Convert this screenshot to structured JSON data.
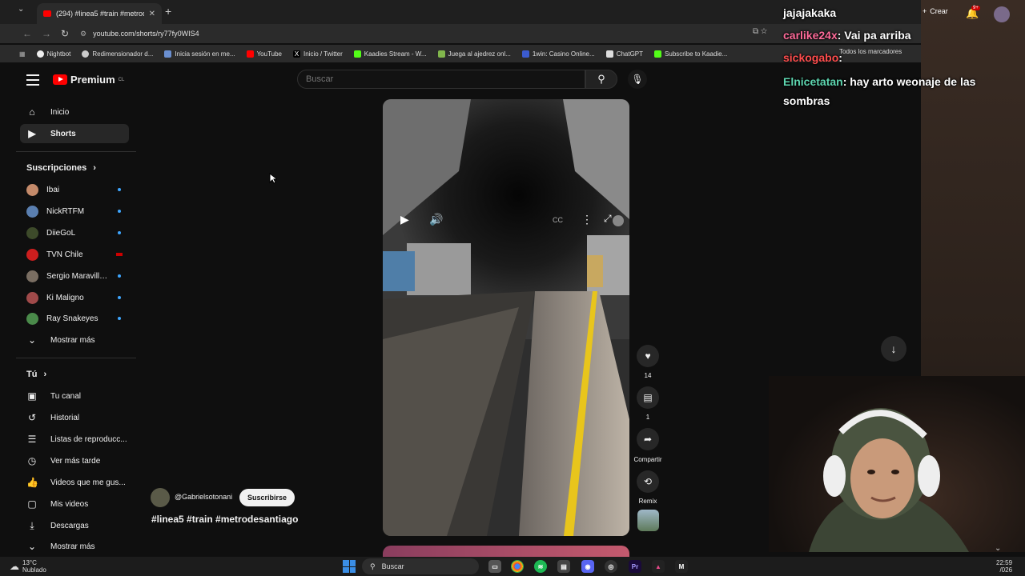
{
  "browser": {
    "tab_title": "(294) #linea5 #train #metrode",
    "url": "youtube.com/shorts/ry77fy0WIS4",
    "bookmarks": [
      "Nightbot",
      "Redimensionador d...",
      "Inicia sesión en me...",
      "YouTube",
      "Inicio / Twitter",
      "Kaadies Stream - W...",
      "Juega al ajedrez onl...",
      "1win: Casino Online...",
      "ChatGPT",
      "Subscribe to Kaadie..."
    ],
    "all_bookmarks": "Todos los marcadores"
  },
  "yt": {
    "logo": "Premium",
    "logo_country": "CL",
    "search_placeholder": "Buscar",
    "crear": "Crear",
    "notif_count": "9+"
  },
  "sidebar": {
    "nav": [
      {
        "label": "Inicio",
        "icon": "home-icon"
      },
      {
        "label": "Shorts",
        "icon": "shorts-icon"
      }
    ],
    "subs_title": "Suscripciones",
    "subs": [
      {
        "label": "Ibai",
        "color": "#c48a6a",
        "live": false
      },
      {
        "label": "NickRTFM",
        "color": "#5a7fb0",
        "live": false
      },
      {
        "label": "DiieGoL",
        "color": "#3d4a2a",
        "live": false
      },
      {
        "label": "TVN Chile",
        "color": "#cc1e1e",
        "live": true
      },
      {
        "label": "Sergio Maravilla ...",
        "color": "#7a6e62",
        "live": false
      },
      {
        "label": "Ki Maligno",
        "color": "#a04a4a",
        "live": false
      },
      {
        "label": "Ray Snakeyes",
        "color": "#4a8a4a",
        "live": false
      }
    ],
    "show_more": "Mostrar más",
    "you_title": "Tú",
    "you_items": [
      {
        "label": "Tu canal",
        "icon": "channel-icon"
      },
      {
        "label": "Historial",
        "icon": "history-icon"
      },
      {
        "label": "Listas de reproducc...",
        "icon": "playlist-icon"
      },
      {
        "label": "Ver más tarde",
        "icon": "clock-icon"
      },
      {
        "label": "Videos que me gus...",
        "icon": "like-icon"
      },
      {
        "label": "Mis videos",
        "icon": "my-videos-icon"
      },
      {
        "label": "Descargas",
        "icon": "download-icon"
      }
    ],
    "show_more_2": "Mostrar más"
  },
  "short": {
    "channel": "@Gabrielsotonani",
    "subscribe": "Suscribirse",
    "tags": "#linea5 #train #metrodesantiago",
    "likes": "14",
    "comments": "1",
    "share": "Compartir",
    "remix": "Remix"
  },
  "chat": [
    {
      "user": "",
      "message": "jajajakaka",
      "color": "#ffffff"
    },
    {
      "user": "carlike24x",
      "message": ": Vai pa arriba",
      "color": "#ff6b9a"
    },
    {
      "user": "sickogabo",
      "message": ":",
      "color": "#ff4d4d"
    },
    {
      "user": "Elnicetatan",
      "message": ": hay arto weonaje de las sombras",
      "color": "#5ed6b0"
    }
  ],
  "taskbar": {
    "temp": "13°C",
    "weather": "Nublado",
    "search": "Buscar",
    "time": "22:59",
    "date": "/026"
  }
}
